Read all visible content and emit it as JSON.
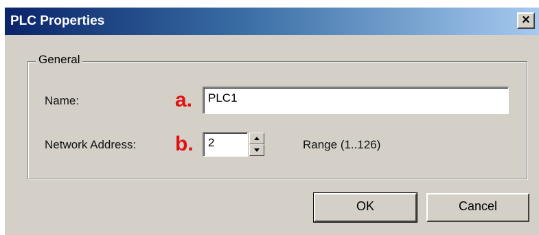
{
  "window": {
    "title": "PLC Properties",
    "close_label": "×"
  },
  "group": {
    "label": "General"
  },
  "fields": {
    "name_label": "Name:",
    "name_marker": "a.",
    "name_value": "PLC1",
    "address_label": "Network Address:",
    "address_marker": "b.",
    "address_value": "2",
    "range_text": "Range (1..126)"
  },
  "buttons": {
    "ok": "OK",
    "cancel": "Cancel"
  },
  "colors": {
    "marker": "#e01010",
    "title_bar": "#0a246a",
    "dialog_bg": "#d4d0c8"
  },
  "icons": {
    "close": "close-icon",
    "spin_up": "arrow-up-icon",
    "spin_down": "arrow-down-icon"
  }
}
